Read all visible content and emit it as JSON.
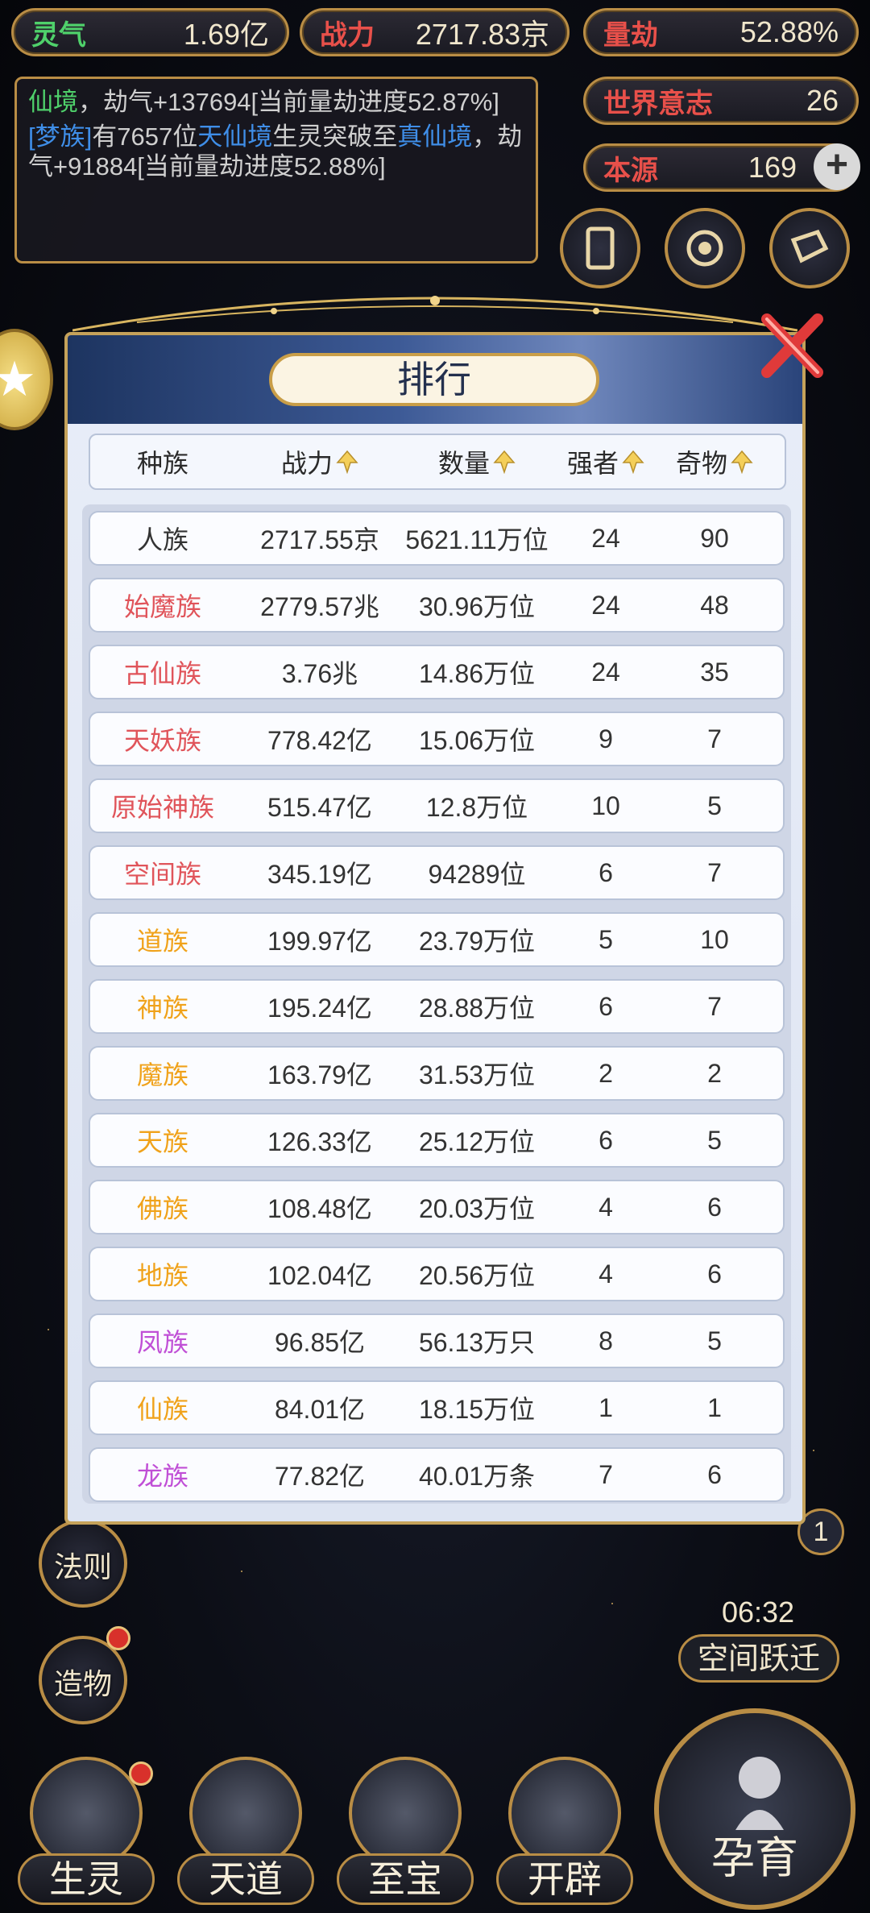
{
  "stats": {
    "lingqi": {
      "label": "灵气",
      "value": "1.69亿"
    },
    "zhanli": {
      "label": "战力",
      "value": "2717.83京"
    },
    "liangjie": {
      "label": "量劫",
      "value": "52.88%"
    },
    "world_will": {
      "label": "世界意志",
      "value": "26"
    },
    "source": {
      "label": "本源",
      "value": "169"
    }
  },
  "log": {
    "line1_realm": "仙境",
    "line1_rest": "，劫气+137694[当前量劫进度52.87%]",
    "line2_tribe": "[梦族]",
    "line2_mid": "有7657位",
    "line2_from": "天仙境",
    "line2_mid2": "生灵突破至",
    "line2_to": "真仙境",
    "line2_rest": "，劫气+91884[当前量劫进度52.88%]"
  },
  "modal": {
    "title": "排行",
    "columns": [
      "种族",
      "战力",
      "数量",
      "强者",
      "奇物"
    ],
    "rows": [
      {
        "name": "人族",
        "power": "2717.55京",
        "count": "5621.11万位",
        "strong": "24",
        "treasure": "90",
        "color": "#333333"
      },
      {
        "name": "始魔族",
        "power": "2779.57兆",
        "count": "30.96万位",
        "strong": "24",
        "treasure": "48",
        "color": "#e0545a"
      },
      {
        "name": "古仙族",
        "power": "3.76兆",
        "count": "14.86万位",
        "strong": "24",
        "treasure": "35",
        "color": "#e0545a"
      },
      {
        "name": "天妖族",
        "power": "778.42亿",
        "count": "15.06万位",
        "strong": "9",
        "treasure": "7",
        "color": "#e0545a"
      },
      {
        "name": "原始神族",
        "power": "515.47亿",
        "count": "12.8万位",
        "strong": "10",
        "treasure": "5",
        "color": "#e0545a"
      },
      {
        "name": "空间族",
        "power": "345.19亿",
        "count": "94289位",
        "strong": "6",
        "treasure": "7",
        "color": "#e0545a"
      },
      {
        "name": "道族",
        "power": "199.97亿",
        "count": "23.79万位",
        "strong": "5",
        "treasure": "10",
        "color": "#f0a21a"
      },
      {
        "name": "神族",
        "power": "195.24亿",
        "count": "28.88万位",
        "strong": "6",
        "treasure": "7",
        "color": "#f0a21a"
      },
      {
        "name": "魔族",
        "power": "163.79亿",
        "count": "31.53万位",
        "strong": "2",
        "treasure": "2",
        "color": "#f0a21a"
      },
      {
        "name": "天族",
        "power": "126.33亿",
        "count": "25.12万位",
        "strong": "6",
        "treasure": "5",
        "color": "#f0a21a"
      },
      {
        "name": "佛族",
        "power": "108.48亿",
        "count": "20.03万位",
        "strong": "4",
        "treasure": "6",
        "color": "#f0a21a"
      },
      {
        "name": "地族",
        "power": "102.04亿",
        "count": "20.56万位",
        "strong": "4",
        "treasure": "6",
        "color": "#f0a21a"
      },
      {
        "name": "凤族",
        "power": "96.85亿",
        "count": "56.13万只",
        "strong": "8",
        "treasure": "5",
        "color": "#c04fd6"
      },
      {
        "name": "仙族",
        "power": "84.01亿",
        "count": "18.15万位",
        "strong": "1",
        "treasure": "1",
        "color": "#f0a21a"
      },
      {
        "name": "龙族",
        "power": "77.82亿",
        "count": "40.01万条",
        "strong": "7",
        "treasure": "6",
        "color": "#c04fd6"
      }
    ]
  },
  "side": {
    "fa_ze": "法则",
    "zao_wu": "造物",
    "timer": "06:32",
    "space_jump": "空间跃迁",
    "count": "1"
  },
  "nav": {
    "sheng_ling": "生灵",
    "tian_dao": "天道",
    "zhi_bao": "至宝",
    "kai_pi": "开辟",
    "yun_yu": "孕育"
  }
}
